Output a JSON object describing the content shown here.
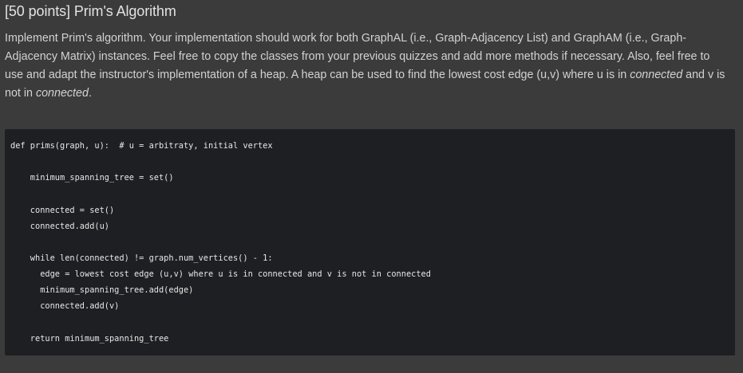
{
  "question": {
    "title": "[50 points] Prim's Algorithm",
    "description": {
      "line1": "Implement Prim's algorithm. Your implementation should work for both GraphAL (i.e., Graph-Adjacency List) and GraphAM (i.e., Graph-",
      "line2": "Adjacency Matrix) instances. Feel free to copy the classes from your previous quizzes and add more methods if necessary. Also, feel free to",
      "line3_a": "use and adapt the instructor's implementation of a heap. A heap can be used to find the lowest cost edge (u,v) where u is in ",
      "line3_em": "connected",
      "line3_b": " and v is",
      "line4_a": "not in ",
      "line4_em": "connected",
      "line4_b": "."
    }
  },
  "code": {
    "lines": [
      "def prims(graph, u):  # u = arbitraty, initial vertex",
      "    minimum_spanning_tree = set()",
      "    connected = set()",
      "    connected.add(u)",
      "    while len(connected) != graph.num_vertices() - 1:",
      "      edge = lowest cost edge (u,v) where u is in connected and v is not in connected",
      "      minimum_spanning_tree.add(edge)",
      "      connected.add(v)",
      "    return minimum_spanning_tree"
    ]
  }
}
